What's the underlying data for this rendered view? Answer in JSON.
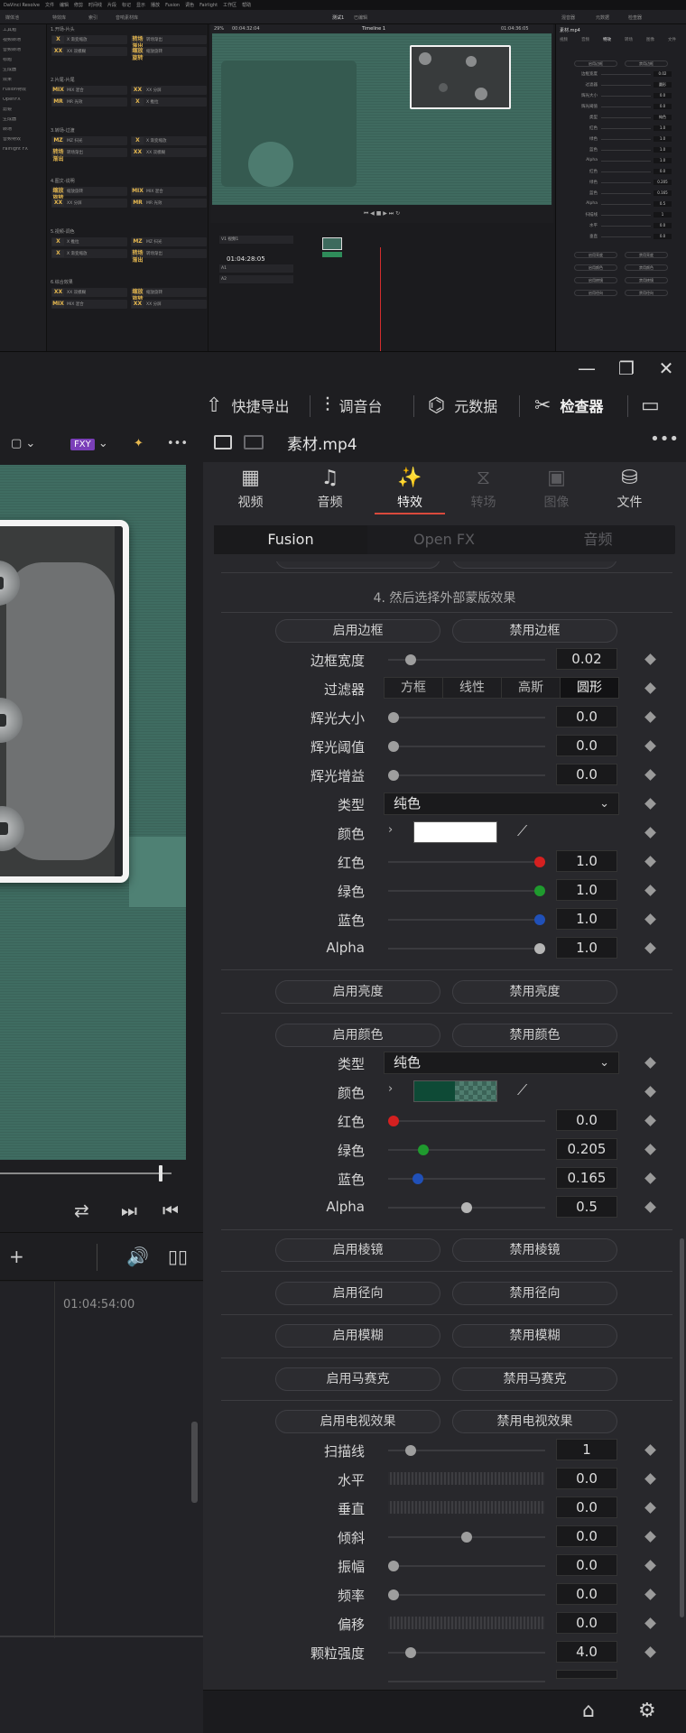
{
  "mini": {
    "menu": [
      "DaVinci Resolve",
      "文件",
      "编辑",
      "修剪",
      "时间线",
      "片段",
      "标记",
      "显示",
      "播放",
      "Fusion",
      "调色",
      "Fairlight",
      "工作区",
      "帮助"
    ],
    "toolbar_left": [
      "媒体池",
      "特效库",
      "索引",
      "音响素材库"
    ],
    "title": "测试1",
    "subtitle": "已编辑",
    "toolbar_right": [
      "混音器",
      "元数据",
      "检查器"
    ],
    "tree": [
      "工具箱",
      "视频转场",
      "音频转场",
      "标题",
      "生成器",
      "效果",
      "Fusion特效",
      "OpenFX",
      "滤镜",
      "生成器",
      "转场",
      "音频特效",
      "Fairlight FX"
    ],
    "fx_sections": [
      "1.开场-片头",
      "2.片尾-片尾",
      "3.转场-过渡",
      "4.图文-说明",
      "5.视频-调色",
      "6.综合效果"
    ],
    "fx_items": [
      "X 渐变缩放",
      "转场渐出",
      "XX 双模糊",
      "缩放旋转",
      "MIX 混合",
      "XX 分屏",
      "MR 光效",
      "X 推拉",
      "MZ 扫光"
    ],
    "viewer_zoom": "29%",
    "viewer_tc": "00:04:32:04",
    "timeline_name": "Timeline 1",
    "viewer_tc2": "01:04:36:05",
    "timeline_tc": "01:04:28:05",
    "tracks": [
      "V1 视频1",
      "A1",
      "A2"
    ],
    "inspector_file": "素材.mp4",
    "inspector_tabs": [
      "视频",
      "音频",
      "特效",
      "转场",
      "图像",
      "文件"
    ],
    "inspector_rows": [
      {
        "label": "边框宽度",
        "value": "0.02"
      },
      {
        "label": "过滤器",
        "value": "圆形"
      },
      {
        "label": "辉光大小",
        "value": "0.0"
      },
      {
        "label": "辉光阈值",
        "value": "0.0"
      },
      {
        "label": "类型",
        "value": "纯色"
      },
      {
        "label": "红色",
        "value": "1.0"
      },
      {
        "label": "绿色",
        "value": "1.0"
      },
      {
        "label": "蓝色",
        "value": "1.0"
      },
      {
        "label": "Alpha",
        "value": "1.0"
      },
      {
        "label": "红色",
        "value": "0.0"
      },
      {
        "label": "绿色",
        "value": "0.205"
      },
      {
        "label": "蓝色",
        "value": "0.165"
      },
      {
        "label": "Alpha",
        "value": "0.5"
      },
      {
        "label": "扫描线",
        "value": "1"
      },
      {
        "label": "水平",
        "value": "0.0"
      },
      {
        "label": "垂直",
        "value": "0.0"
      }
    ],
    "mini_buttons": [
      "启用边框",
      "禁用边框",
      "启用亮度",
      "禁用亮度",
      "启用颜色",
      "禁用颜色",
      "启用棱镜",
      "禁用棱镜",
      "启用径向",
      "禁用径向"
    ]
  },
  "window": {
    "minimize": "—",
    "maximize": "❐",
    "close": "✕"
  },
  "topbar": [
    {
      "icon": "⇧",
      "label": "快捷导出"
    },
    {
      "icon": "⫶",
      "label": "调音台"
    },
    {
      "icon": "⌬",
      "label": "元数据"
    },
    {
      "icon": "✂",
      "label": "检查器"
    }
  ],
  "viewer_toolbar": {
    "fx_badge": "FXY",
    "more": "•••"
  },
  "viewer": {
    "timeline_tc": "01:04:54:00"
  },
  "inspector": {
    "filename": "素材.mp4",
    "more": "•••",
    "tabs": [
      {
        "icon": "▦",
        "label": "视频"
      },
      {
        "icon": "♫",
        "label": "音频"
      },
      {
        "icon": "✨",
        "label": "特效"
      },
      {
        "icon": "⧖",
        "label": "转场"
      },
      {
        "icon": "▣",
        "label": "图像"
      },
      {
        "icon": "⛁",
        "label": "文件"
      }
    ],
    "subtabs": [
      "Fusion",
      "Open FX",
      "音频"
    ],
    "note": "4. 然后选择外部蒙版效果",
    "border": {
      "enable": "启用边框",
      "disable": "禁用边框",
      "width": {
        "label": "边框宽度",
        "value": "0.02",
        "level": 0.12
      },
      "filter": {
        "label": "过滤器",
        "options": [
          "方框",
          "线性",
          "高斯",
          "圆形"
        ],
        "selected": "圆形"
      },
      "glow_size": {
        "label": "辉光大小",
        "value": "0.0",
        "level": 0
      },
      "glow_threshold": {
        "label": "辉光阈值",
        "value": "0.0",
        "level": 0
      },
      "glow_gain": {
        "label": "辉光增益",
        "value": "0.0",
        "level": 0
      },
      "type": {
        "label": "类型",
        "value": "纯色"
      },
      "color": {
        "label": "颜色",
        "swatch": "#ffffff"
      },
      "red": {
        "label": "红色",
        "value": "1.0",
        "level": 1,
        "dot": "#d42020"
      },
      "green": {
        "label": "绿色",
        "value": "1.0",
        "level": 1,
        "dot": "#1f9a2e"
      },
      "blue": {
        "label": "蓝色",
        "value": "1.0",
        "level": 1,
        "dot": "#2050b8"
      },
      "alpha": {
        "label": "Alpha",
        "value": "1.0",
        "level": 1,
        "dot": "#b5b5b5"
      }
    },
    "brightness": {
      "enable": "启用亮度",
      "disable": "禁用亮度"
    },
    "color": {
      "enable": "启用颜色",
      "disable": "禁用颜色",
      "type": {
        "label": "类型",
        "value": "纯色"
      },
      "color": {
        "label": "颜色",
        "swatch": "#0e4a36"
      },
      "red": {
        "label": "红色",
        "value": "0.0",
        "level": 0,
        "dot": "#d42020"
      },
      "green": {
        "label": "绿色",
        "value": "0.205",
        "level": 0.205,
        "dot": "#1f9a2e"
      },
      "blue": {
        "label": "蓝色",
        "value": "0.165",
        "level": 0.165,
        "dot": "#2050b8"
      },
      "alpha": {
        "label": "Alpha",
        "value": "0.5",
        "level": 0.5,
        "dot": "#b5b5b5"
      }
    },
    "prism": {
      "enable": "启用棱镜",
      "disable": "禁用棱镜"
    },
    "radial": {
      "enable": "启用径向",
      "disable": "禁用径向"
    },
    "blur": {
      "enable": "启用模糊",
      "disable": "禁用模糊"
    },
    "mosaic": {
      "enable": "启用马赛克",
      "disable": "禁用马赛克"
    },
    "tv": {
      "enable": "启用电视效果",
      "disable": "禁用电视效果",
      "scanlines": {
        "label": "扫描线",
        "value": "1",
        "level": 0.12
      },
      "horizontal": {
        "label": "水平",
        "value": "0.0"
      },
      "vertical": {
        "label": "垂直",
        "value": "0.0"
      },
      "skew": {
        "label": "倾斜",
        "value": "0.0",
        "level": 0.5
      },
      "amplitude": {
        "label": "振幅",
        "value": "0.0",
        "level": 0
      },
      "frequency": {
        "label": "频率",
        "value": "0.0",
        "level": 0
      },
      "offset": {
        "label": "偏移",
        "value": "0.0"
      },
      "grain": {
        "label": "颗粒强度",
        "value": "4.0",
        "level": 0.12
      }
    }
  },
  "bottom": {
    "home": "⌂",
    "settings": "⚙"
  }
}
